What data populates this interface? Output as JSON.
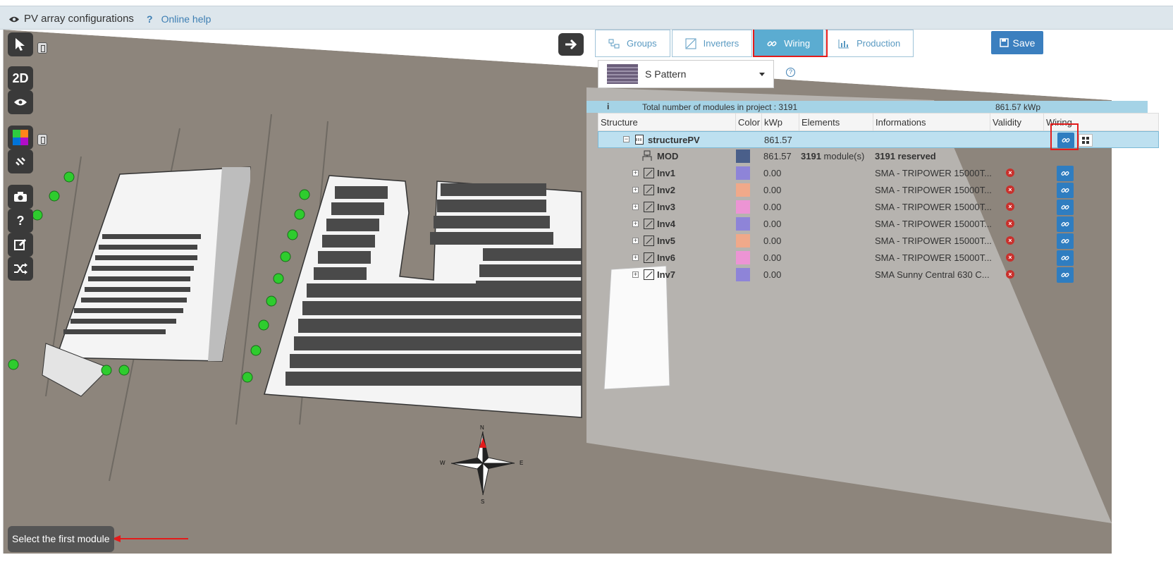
{
  "window": {
    "title": "PV array configurations",
    "help_link": "Online help"
  },
  "toolbar": {
    "select_tool": "select-cursor",
    "view_2d_label": "2D",
    "visibility_tool": "eye",
    "color_tool": "color-grid",
    "link_tool": "unlink",
    "camera_tool": "camera",
    "help_label": "?",
    "edit_tool": "edit",
    "shuffle_tool": "shuffle"
  },
  "hint": {
    "text": "Select the first module"
  },
  "compass": {
    "n": "N",
    "e": "E",
    "s": "S",
    "w": "W"
  },
  "tabs": [
    {
      "label": "Groups",
      "icon": "groups-icon",
      "active": false
    },
    {
      "label": "Inverters",
      "icon": "inverter-icon",
      "active": false
    },
    {
      "label": "Wiring",
      "icon": "link-icon",
      "active": true
    },
    {
      "label": "Production",
      "icon": "bar-chart-icon",
      "active": false
    }
  ],
  "save_label": "Save",
  "pattern_select": {
    "value": "S Pattern"
  },
  "summary": {
    "info_icon": "i",
    "modules_text": "Total number of modules in project : 3191",
    "kwp_text": "861.57 kWp"
  },
  "table": {
    "headers": {
      "structure": "Structure",
      "color": "Color",
      "kwp": "kWp",
      "elements": "Elements",
      "informations": "Informations",
      "validity": "Validity",
      "wiring": "Wiring"
    },
    "root": {
      "expander": "−",
      "name": "structurePV",
      "kwp": "861.57"
    },
    "mod": {
      "name": "MOD",
      "color": "#4a5f8a",
      "kwp": "861.57",
      "elements_count": "3191",
      "elements_unit": "module(s)",
      "info": "3191 reserved"
    },
    "inverters": [
      {
        "name": "Inv1",
        "color": "#8e84d8",
        "kwp": "0.00",
        "info": "SMA - TRIPOWER 15000T..."
      },
      {
        "name": "Inv2",
        "color": "#f0a98a",
        "kwp": "0.00",
        "info": "SMA - TRIPOWER 15000T..."
      },
      {
        "name": "Inv3",
        "color": "#ec94d4",
        "kwp": "0.00",
        "info": "SMA - TRIPOWER 15000T..."
      },
      {
        "name": "Inv4",
        "color": "#8e84d8",
        "kwp": "0.00",
        "info": "SMA - TRIPOWER 15000T..."
      },
      {
        "name": "Inv5",
        "color": "#f0a98a",
        "kwp": "0.00",
        "info": "SMA - TRIPOWER 15000T..."
      },
      {
        "name": "Inv6",
        "color": "#ec94d4",
        "kwp": "0.00",
        "info": "SMA - TRIPOWER 15000T..."
      },
      {
        "name": "Inv7",
        "color": "#8e84d8",
        "kwp": "0.00",
        "info": "SMA Sunny Central 630 C..."
      }
    ],
    "expander_plus": "+",
    "error_mark": "×"
  }
}
